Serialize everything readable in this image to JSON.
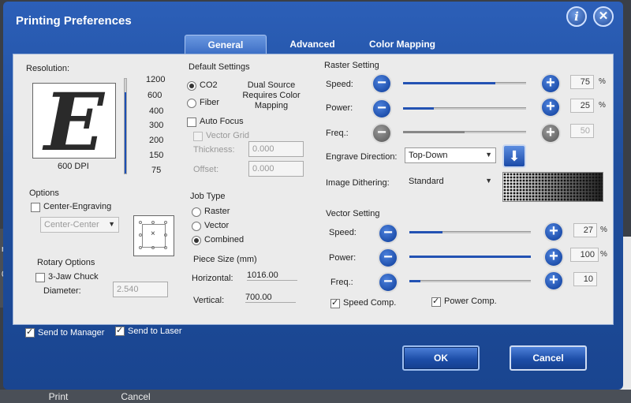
{
  "window": {
    "title": "Printing Preferences"
  },
  "tabs": [
    {
      "label": "General"
    },
    {
      "label": "Advanced"
    },
    {
      "label": "Color Mapping"
    }
  ],
  "resolution": {
    "label": "Resolution:",
    "preview_letter": "E",
    "current": "600 DPI",
    "levels": [
      "1200",
      "600",
      "400",
      "300",
      "200",
      "150",
      "75"
    ],
    "selected_fraction": 0.86
  },
  "default_settings": {
    "label": "Default Settings",
    "co2": "CO2",
    "fiber": "Fiber",
    "dual_source_note": "Dual Source Requires Color Mapping",
    "auto_focus": "Auto Focus",
    "vector_grid": "Vector Grid",
    "thickness_label": "Thickness:",
    "thickness_value": "0.000",
    "offset_label": "Offset:",
    "offset_value": "0.000"
  },
  "options": {
    "label": "Options",
    "center_engraving": "Center-Engraving",
    "center_select": "Center-Center"
  },
  "rotary": {
    "label": "Rotary Options",
    "jaw_chuck": "3-Jaw Chuck",
    "diameter_label": "Diameter:",
    "diameter_value": "2.540"
  },
  "job_type": {
    "label": "Job Type",
    "raster": "Raster",
    "vector": "Vector",
    "combined": "Combined"
  },
  "piece_size": {
    "label": "Piece Size (mm)",
    "horizontal_label": "Horizontal:",
    "horizontal_value": "1016.00",
    "vertical_label": "Vertical:",
    "vertical_value": "700.00"
  },
  "raster": {
    "label": "Raster Setting",
    "speed_label": "Speed:",
    "speed_value": "75",
    "power_label": "Power:",
    "power_value": "25",
    "freq_label": "Freq.:",
    "freq_value": "50",
    "percent": "%",
    "engrave_direction_label": "Engrave Direction:",
    "engrave_direction_value": "Top-Down",
    "dithering_label": "Image Dithering:",
    "dithering_value": "Standard"
  },
  "vector": {
    "label": "Vector Setting",
    "speed_label": "Speed:",
    "speed_value": "27",
    "power_label": "Power:",
    "power_value": "100",
    "freq_label": "Freq.:",
    "freq_value": "10",
    "percent": "%",
    "speed_comp": "Speed Comp.",
    "power_comp": "Power Comp."
  },
  "footer": {
    "send_to_manager": "Send to Manager",
    "send_to_laser": "Send to Laser",
    "ok": "OK",
    "cancel": "Cancel"
  },
  "background": {
    "left_text_1": "rs",
    "left_text_2": "0",
    "print": "Print",
    "cancel": "Cancel"
  },
  "icons": {
    "help": "help-icon",
    "close": "close-icon",
    "minus": "minus-icon",
    "plus": "plus-icon",
    "direction": "arrow-down-icon"
  }
}
